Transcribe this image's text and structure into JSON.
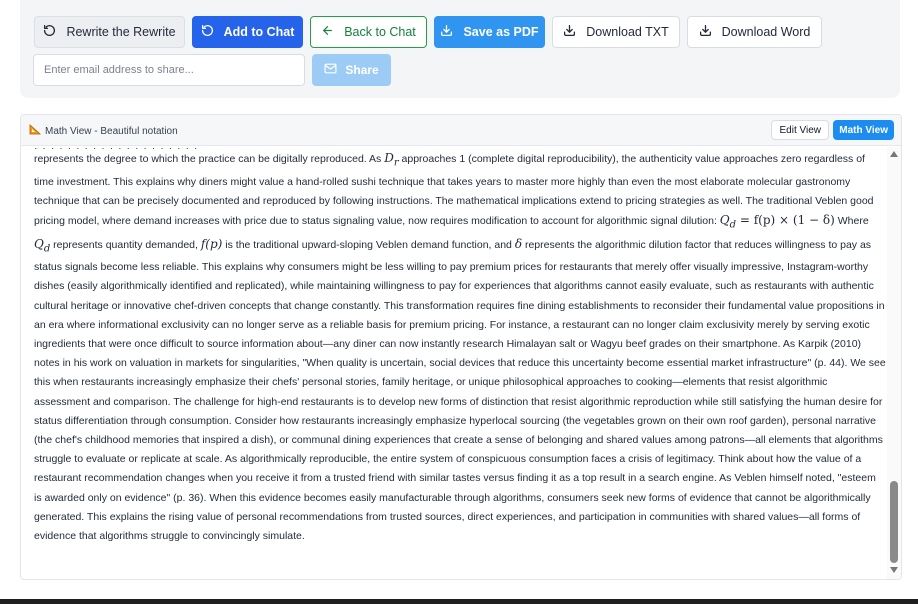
{
  "toolbar": {
    "rewrite_label": "Rewrite the Rewrite",
    "add_label": "Add to Chat",
    "back_label": "Back to Chat",
    "pdf_label": "Save as PDF",
    "txt_label": "Download TXT",
    "word_label": "Download Word",
    "email_placeholder": "Enter email address to share...",
    "share_label": "Share"
  },
  "colors": {
    "primary": "#2563eb",
    "accent_blue": "#2f95f0",
    "back_green": "#22a045",
    "share_disabled": "#9ccbf6"
  },
  "math_view": {
    "title": "Math View - Beautiful notation",
    "edit_label": "Edit View",
    "math_label": "Math View",
    "clipped_line": "·  ·  ·  ·  ·  ·  ·  ·  ·  ·  ·  ·  ·  ·  ·  ·  ·  ·  ·  ·",
    "para1_a": "represents the degree to which the practice can be digitally reproduced. As ",
    "para1_b": " approaches 1 (complete digital reproducibility), the authenticity value approaches zero regardless of time investment. This explains why diners might value a hand-rolled sushi technique that takes years to master more highly than even the most elaborate molecular gastronomy technique that can be precisely documented and reproduced by following instructions. The mathematical implications extend to pricing strategies as well. The traditional Veblen good pricing model, where demand increases with price due to status signaling value, now requires modification to account for algorithmic signal dilution: ",
    "para1_c": " Where ",
    "para1_d": " represents quantity demanded, ",
    "para1_e": " is the traditional upward-sloping Veblen demand function, and ",
    "para1_f": " represents the algorithmic dilution factor that reduces willingness to pay as status signals become less reliable. This explains why consumers might be less willing to pay premium prices for restaurants that merely offer visually impressive, Instagram-worthy dishes (easily algorithmically identified and replicated), while maintaining willingness to pay for experiences that algorithms cannot easily evaluate, such as restaurants with authentic cultural heritage or innovative chef-driven concepts that change constantly. This transformation requires fine dining establishments to reconsider their fundamental value propositions in an era where informational exclusivity can no longer serve as a reliable basis for premium pricing. For instance, a restaurant can no longer claim exclusivity merely by serving exotic ingredients that were once difficult to source information about—any diner can now instantly research Himalayan salt or Wagyu beef grades on their smartphone. As Karpik (2010) notes in his work on valuation in markets for singularities, \"When quality is uncertain, social devices that reduce this uncertainty become essential market infrastructure\" (p. 44). We see this when restaurants increasingly emphasize their chefs' personal stories, family heritage, or unique philosophical approaches to cooking—elements that resist algorithmic assessment and comparison. The challenge for high-end restaurants is to develop new forms of distinction that resist algorithmic reproduction while still satisfying the human desire for status differentiation through consumption. Consider how restaurants increasingly emphasize hyperlocal sourcing (the vegetables grown on their own roof garden), personal narrative (the chef's childhood memories that inspired a dish), or communal dining experiences that create a sense of belonging and shared values among patrons—all elements that algorithms struggle to evaluate or replicate at scale. As algorithmically reproducible, the entire system of conspicuous consumption faces a crisis of legitimacy. Think about how the value of a restaurant recommendation changes when you receive it from a trusted friend with similar tastes versus finding it as a top result in a search engine. As Veblen himself noted, \"esteem is awarded only on evidence\" (p. 36). When this evidence becomes easily manufacturable through algorithms, consumers seek new forms of evidence that cannot be algorithmically generated. This explains the rising value of personal recommendations from trusted sources, direct experiences, and participation in communities with shared values—all forms of evidence that algorithms struggle to convincingly simulate.",
    "math": {
      "dr_base": "D",
      "dr_sub": "r",
      "eq_lhs_base": "Q",
      "eq_lhs_sub": "d",
      "eq_rhs": "= f(p) × (1 − δ)",
      "qd_base": "Q",
      "qd_sub": "d",
      "fp": "f(p)",
      "delta": "δ"
    }
  }
}
